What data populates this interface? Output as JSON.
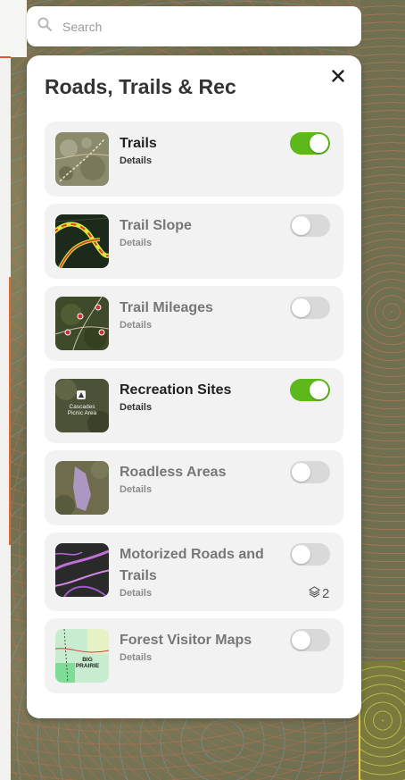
{
  "search": {
    "placeholder": "Search"
  },
  "panel": {
    "title": "Roads, Trails & Rec",
    "layers": [
      {
        "name": "Trails",
        "details": "Details",
        "enabled": true,
        "thumb": "trails-thumbnail"
      },
      {
        "name": "Trail Slope",
        "details": "Details",
        "enabled": false,
        "thumb": "trail-slope-thumbnail"
      },
      {
        "name": "Trail Mileages",
        "details": "Details",
        "enabled": false,
        "thumb": "trail-mileages-thumbnail"
      },
      {
        "name": "Recreation Sites",
        "details": "Details",
        "enabled": true,
        "thumb": "recreation-sites-thumbnail",
        "thumb_text": [
          "Cascades",
          "Picnic Area"
        ]
      },
      {
        "name": "Roadless Areas",
        "details": "Details",
        "enabled": false,
        "thumb": "roadless-areas-thumbnail"
      },
      {
        "name": "Motorized Roads and Trails",
        "details": "Details",
        "enabled": false,
        "thumb": "motorized-roads-thumbnail",
        "sublayer_count": "2"
      },
      {
        "name": "Forest Visitor Maps",
        "details": "Details",
        "enabled": false,
        "thumb": "forest-visitor-maps-thumbnail",
        "thumb_text": [
          "BIG",
          "PRAIRIE"
        ]
      }
    ]
  },
  "colors": {
    "toggle_on": "#5eb81b",
    "toggle_off": "#d9d9d9",
    "card_bg": "#f2f2f2"
  },
  "icons": {
    "search": "search-icon",
    "close": "close-icon",
    "layers": "layers-icon"
  }
}
